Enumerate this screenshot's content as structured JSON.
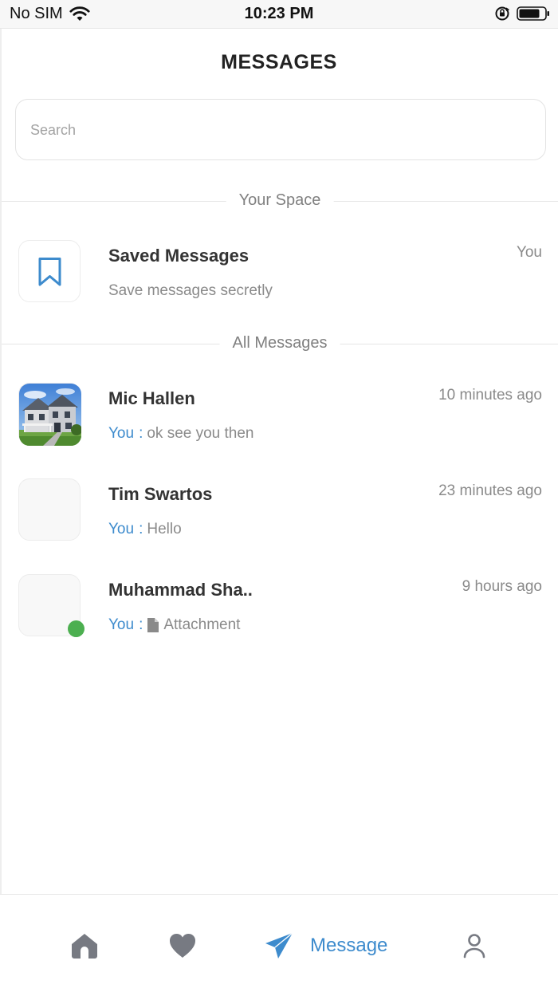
{
  "status_bar": {
    "carrier": "No SIM",
    "time": "10:23 PM"
  },
  "header": {
    "title": "MESSAGES"
  },
  "search": {
    "placeholder": "Search",
    "value": ""
  },
  "sections": {
    "your_space": "Your Space",
    "all_messages": "All Messages"
  },
  "saved_messages": {
    "name": "Saved Messages",
    "subtitle": "Save messages secretly",
    "meta": "You",
    "icon": "bookmark-icon"
  },
  "conversations": [
    {
      "name": "Mic Hallen",
      "time": "10 minutes ago",
      "sender": "You",
      "separator": ":",
      "preview": "ok see you then",
      "avatar": "house-photo",
      "online": false
    },
    {
      "name": "Tim Swartos",
      "time": "23 minutes ago",
      "sender": "You",
      "separator": ":",
      "preview": "Hello",
      "avatar": "blank",
      "online": false
    },
    {
      "name": "Muhammad Sha..",
      "time": "9 hours ago",
      "sender": "You",
      "separator": ":",
      "preview": "Attachment",
      "preview_icon": "file-icon",
      "avatar": "blank",
      "online": true
    }
  ],
  "tab_bar": {
    "tabs": [
      {
        "icon": "home-icon",
        "label": "",
        "active": false
      },
      {
        "icon": "heart-icon",
        "label": "",
        "active": false
      },
      {
        "icon": "send-icon",
        "label": "Message",
        "active": true
      },
      {
        "icon": "user-icon",
        "label": "",
        "active": false
      }
    ]
  },
  "colors": {
    "accent": "#3d8bcd",
    "inactive_icon": "#777a82",
    "online": "#4caf50",
    "muted_text": "#8a8a8a"
  }
}
